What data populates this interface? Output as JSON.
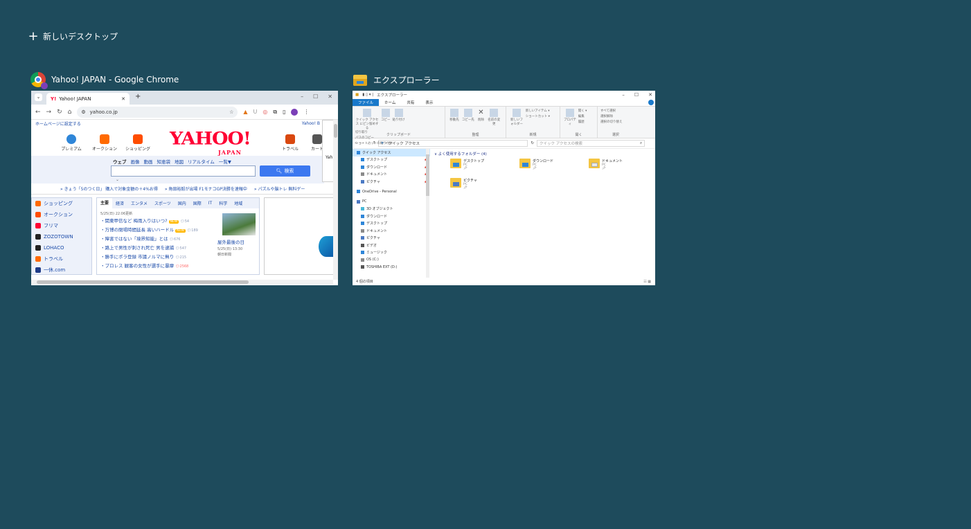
{
  "new_desktop": {
    "label": "新しいデスクトップ"
  },
  "windows": [
    {
      "title": "Yahoo! JAPAN - Google Chrome"
    },
    {
      "title": "エクスプローラー"
    }
  ],
  "chrome": {
    "tab_title": "Yahoo! JAPAN",
    "tab_icon": "Y!",
    "url": "yahoo.co.jp",
    "yahoo": {
      "set_home": "ホームページに設定する",
      "top_right": "Yahoo! B",
      "services": [
        "プレミアム",
        "オークション",
        "ショッピング"
      ],
      "services_right": [
        "トラベル",
        "カート"
      ],
      "logo": "YAHOO!",
      "logo_sub": "JAPAN",
      "search_tabs": [
        "ウェブ",
        "画像",
        "動画",
        "知恵袋",
        "地図",
        "リアルタイム",
        "一覧▼"
      ],
      "search_button": "検索",
      "ticker": [
        "» きょう「5のつく日」 購入で対象金額の＋4%お得",
        "» 角田裕毅が出場 F1モナコGP決勝を速報中",
        "» パズルや脳トレ 無料ゲー"
      ],
      "side": [
        {
          "label": "ショッピング",
          "color": "#ff6a00"
        },
        {
          "label": "オークション",
          "color": "#ff4d00"
        },
        {
          "label": "フリマ",
          "color": "#ff0033"
        },
        {
          "label": "ZOZOTOWN",
          "color": "#222222"
        },
        {
          "label": "LOHACO",
          "color": "#222222"
        },
        {
          "label": "トラベル",
          "color": "#ff6a00"
        },
        {
          "label": "一休.com",
          "color": "#1f3c88"
        }
      ],
      "news_tabs": [
        "主要",
        "経済",
        "エンタメ",
        "スポーツ",
        "国内",
        "国際",
        "IT",
        "科学",
        "地域"
      ],
      "news_time": "5/25(日) 22:06更新",
      "news": [
        {
          "text": "・関東甲信など 梅雨入りはいつ?",
          "new": "NEW",
          "count": "54"
        },
        {
          "text": "・万博の閉場時間延長 高いハードル",
          "new": "NEW",
          "count": "189"
        },
        {
          "text": "・障害ではない「境界知能」とは",
          "new": "",
          "count": "676"
        },
        {
          "text": "・路上で男性が刺され死亡 男を逮捕",
          "new": "",
          "count": "547"
        },
        {
          "text": "・勝手にポラ登録 市議ノルマに無り",
          "new": "",
          "count": "215"
        },
        {
          "text": "・プロレス 観客の女性が選手に暴摩",
          "new": "",
          "count": "2568"
        }
      ],
      "photo_caption": "屋外最後の日",
      "photo_date": "5/25(日) 13:30",
      "photo_source": "朝日新聞",
      "popup_text": "Yah"
    }
  },
  "explorer": {
    "title": "エクスプローラー",
    "ribbon_tabs": [
      "ファイル",
      "ホーム",
      "共有",
      "表示"
    ],
    "groups": {
      "clipboard": {
        "label": "クリップボード",
        "pin": "クイック アクセス にピン留めする",
        "copy": "コピー",
        "paste": "貼り付け",
        "cut": "切り取り",
        "copy_path": "パスのコピー",
        "paste_shortcut": "ショートカットの貼り付け"
      },
      "organize": {
        "label": "整理",
        "move": "移動先",
        "copyto": "コピー先",
        "delete": "削除",
        "rename": "名前の変更"
      },
      "new": {
        "label": "新規",
        "new_folder": "新しいフォルダー",
        "new_item": "新しいアイテム ▾",
        "shortcut": "ショートカット ▾"
      },
      "open": {
        "label": "開く",
        "props": "プロパティ",
        "open": "開く ▾",
        "edit": "編集",
        "history": "履歴"
      },
      "select": {
        "label": "選択",
        "all": "すべて選択",
        "none": "選択解除",
        "invert": "選択の切り替え"
      }
    },
    "address": "クイック アクセス",
    "search_placeholder": "クイック アクセスの検索",
    "nav": [
      {
        "label": "クイック アクセス",
        "color": "#2f86d8",
        "pin": ""
      },
      {
        "label": "デスクトップ",
        "color": "#2f86d8",
        "pin": "📌"
      },
      {
        "label": "ダウンロード",
        "color": "#2f86d8",
        "pin": "📌"
      },
      {
        "label": "ドキュメント",
        "color": "#8a8a8a",
        "pin": "📌"
      },
      {
        "label": "ピクチャ",
        "color": "#4b7ac4",
        "pin": "📌"
      },
      {
        "label": "OneDrive - Personal",
        "color": "#2f86d8",
        "pin": ""
      },
      {
        "label": "PC",
        "color": "#4b7ac4",
        "pin": ""
      },
      {
        "label": "3D オブジェクト",
        "color": "#48b8d8",
        "pin": ""
      },
      {
        "label": "ダウンロード",
        "color": "#2f86d8",
        "pin": ""
      },
      {
        "label": "デスクトップ",
        "color": "#2f86d8",
        "pin": ""
      },
      {
        "label": "ドキュメント",
        "color": "#8a8a8a",
        "pin": ""
      },
      {
        "label": "ピクチャ",
        "color": "#4b7ac4",
        "pin": ""
      },
      {
        "label": "ビデオ",
        "color": "#555555",
        "pin": ""
      },
      {
        "label": "ミュージック",
        "color": "#2f86d8",
        "pin": ""
      },
      {
        "label": "OS (C:)",
        "color": "#888888",
        "pin": ""
      },
      {
        "label": "TOSHIBA EXT (D:)",
        "color": "#555555",
        "pin": ""
      }
    ],
    "section_head": "∨ よく使用するフォルダー (4)",
    "folders": [
      {
        "name": "デスクトップ",
        "sub": "PC",
        "accent": "#2f86d8"
      },
      {
        "name": "ダウンロード",
        "sub": "PC",
        "accent": "#2f86d8"
      },
      {
        "name": "ドキュメント",
        "sub": "PC",
        "accent": "#e8e8e8"
      },
      {
        "name": "ピクチャ",
        "sub": "PC",
        "accent": "#4b7ac4"
      }
    ],
    "status": "4 個の項目"
  }
}
